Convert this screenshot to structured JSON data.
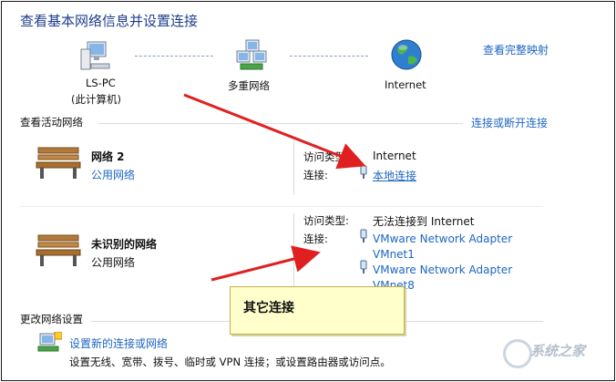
{
  "header": {
    "title": "查看基本网络信息并设置连接",
    "view_full_map": "查看完整映射"
  },
  "map": {
    "pc_name": "LS-PC",
    "pc_subtitle": "(此计算机)",
    "multi_network": "多重网络",
    "internet": "Internet"
  },
  "active": {
    "section_title": "查看活动网络",
    "connect_disconnect": "连接或断开连接",
    "networks": [
      {
        "name": "网络  2",
        "type": "公用网络",
        "access_label": "访问类型:",
        "access_value": "Internet",
        "connection_label": "连接:",
        "connections": [
          "本地连接"
        ]
      },
      {
        "name": "未识别的网络",
        "type": "公用网络",
        "access_label": "访问类型:",
        "access_value": "无法连接到 Internet",
        "connection_label": "连接:",
        "connections": [
          "VMware Network Adapter VMnet1",
          "VMware Network Adapter VMnet8"
        ]
      }
    ]
  },
  "change": {
    "section_title": "更改网络设置",
    "setup_link": "设置新的连接或网络",
    "setup_desc": "设置无线、宽带、拨号、临时或 VPN 连接；或设置路由器或访问点。"
  },
  "annotation": {
    "callout_text": "其它连接"
  },
  "watermark": {
    "text": "系统之家"
  },
  "colors": {
    "title": "#1e3e8c",
    "link": "#1e66c2",
    "arrow": "#e02020",
    "callout_bg": "#ffffcc"
  },
  "icons": {
    "pc": "computer-icon",
    "network": "network-icon",
    "internet": "globe-icon",
    "bench": "bench-icon",
    "adapter": "network-adapter-icon",
    "setup": "network-setup-icon"
  }
}
